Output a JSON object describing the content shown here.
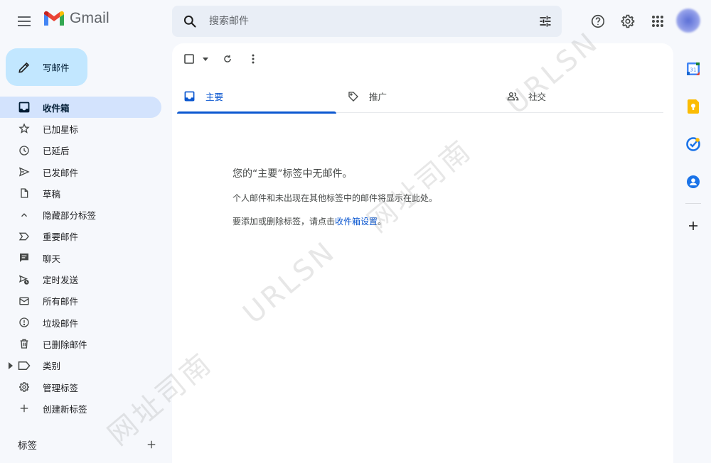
{
  "app": {
    "logo_text": "Gmail"
  },
  "search": {
    "placeholder": "搜索邮件"
  },
  "compose": {
    "label": "写邮件"
  },
  "nav": {
    "items": [
      {
        "label": "收件箱",
        "icon": "inbox-icon",
        "active": true
      },
      {
        "label": "已加星标",
        "icon": "star-icon"
      },
      {
        "label": "已延后",
        "icon": "clock-icon"
      },
      {
        "label": "已发邮件",
        "icon": "send-icon"
      },
      {
        "label": "草稿",
        "icon": "draft-icon"
      },
      {
        "label": "隐藏部分标签",
        "icon": "chevron-up-icon"
      },
      {
        "label": "重要邮件",
        "icon": "important-icon"
      },
      {
        "label": "聊天",
        "icon": "chat-icon"
      },
      {
        "label": "定时发送",
        "icon": "scheduled-send-icon"
      },
      {
        "label": "所有邮件",
        "icon": "all-mail-icon"
      },
      {
        "label": "垃圾邮件",
        "icon": "spam-icon"
      },
      {
        "label": "已删除邮件",
        "icon": "trash-icon"
      },
      {
        "label": "类别",
        "icon": "label-icon"
      },
      {
        "label": "管理标签",
        "icon": "gear-icon"
      },
      {
        "label": "创建新标签",
        "icon": "plus-icon"
      }
    ]
  },
  "labels": {
    "title": "标签"
  },
  "tabs": [
    {
      "label": "主要",
      "icon": "inbox-icon",
      "active": true
    },
    {
      "label": "推广",
      "icon": "tag-icon"
    },
    {
      "label": "社交",
      "icon": "people-icon"
    }
  ],
  "empty_state": {
    "title": "您的“主要”标签中无邮件。",
    "line1": "个人邮件和未出现在其他标签中的邮件将显示在此处。",
    "line2_prefix": "要添加或删除标签，请点击",
    "line2_link": "收件箱设置",
    "line2_suffix": "。"
  },
  "watermark": {
    "text_en": "URLSN",
    "text_cn": "网址司南"
  },
  "colors": {
    "accent": "#0b57d0",
    "compose_bg": "#c2e7ff",
    "active_nav": "#d3e3fd"
  }
}
